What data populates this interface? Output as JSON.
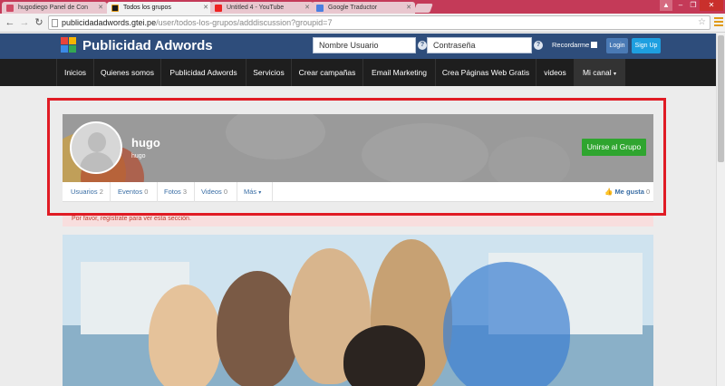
{
  "browser": {
    "tabs": [
      {
        "title": "hugodiego Panel de Con",
        "active": false
      },
      {
        "title": "Todos los grupos",
        "active": true
      },
      {
        "title": "Untitled 4 - YouTube",
        "active": false
      },
      {
        "title": "Google Traductor",
        "active": false
      }
    ],
    "url_host": "publicidadadwords.gtei.pe",
    "url_path": "/user/todos-los-grupos/adddiscussion?groupid=7"
  },
  "site": {
    "logo_text": "Publicidad Adwords",
    "username_placeholder": "Nombre Usuario",
    "password_placeholder": "Contraseña",
    "remember_label": "Recordarme",
    "login_label": "Login",
    "signup_label": "Sign Up",
    "help_glyph": "?"
  },
  "nav": {
    "items": [
      "Inicios",
      "Quienes somos",
      "Publicidad Adwords",
      "Servicios",
      "Crear campañas",
      "Email Marketing",
      "Crea Páginas Web Gratis",
      "videos",
      "Mi canal"
    ]
  },
  "group": {
    "name": "hugo",
    "subtitle": "hugo",
    "join_label": "Unirse al Grupo",
    "tabs": [
      {
        "label": "Usuarios",
        "count": "2"
      },
      {
        "label": "Eventos",
        "count": "0"
      },
      {
        "label": "Fotos",
        "count": "3"
      },
      {
        "label": "Videos",
        "count": "0"
      }
    ],
    "more_label": "Más",
    "like_label": "Me gusta",
    "like_count": "0"
  },
  "alert_text": "Por favor, regístrate para ver esta sección.",
  "colors": {
    "site_header": "#2e4d7b",
    "nav_bg": "#1e1e1e",
    "join_button": "#2fa52f",
    "highlight": "#e01b24"
  }
}
